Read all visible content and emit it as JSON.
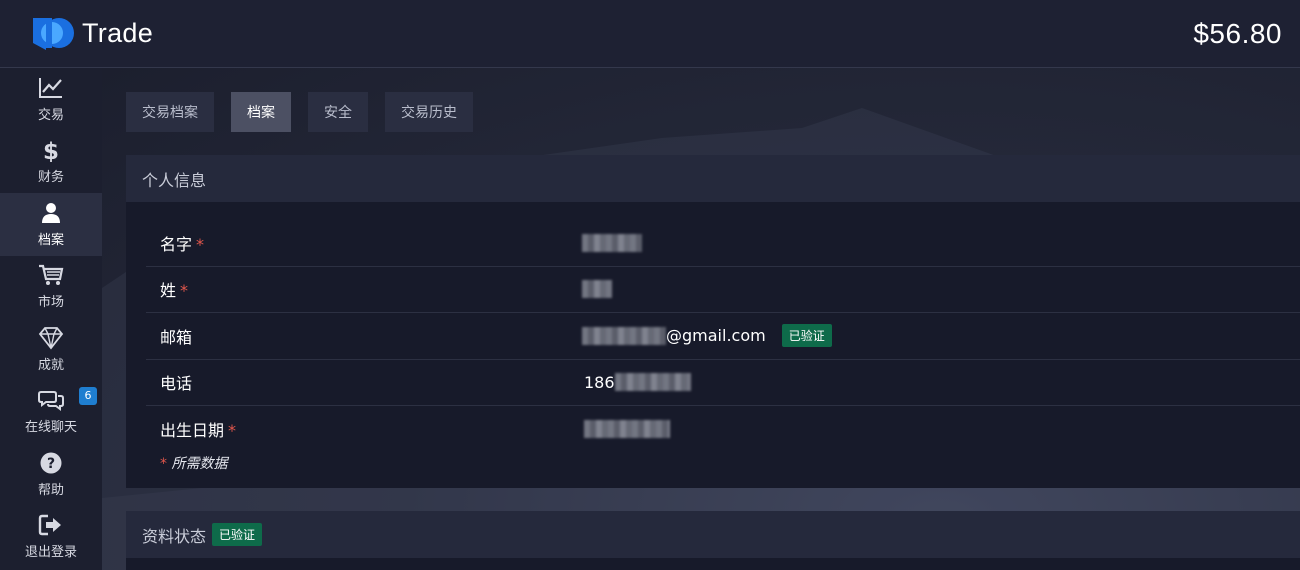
{
  "header": {
    "brand": "Trade",
    "balance": "$56.80"
  },
  "sidebar": {
    "items": [
      {
        "label": "交易",
        "icon": "chart-icon"
      },
      {
        "label": "财务",
        "icon": "dollar-icon"
      },
      {
        "label": "档案",
        "icon": "user-icon",
        "active": true
      },
      {
        "label": "市场",
        "icon": "cart-icon"
      },
      {
        "label": "成就",
        "icon": "diamond-icon"
      },
      {
        "label": "在线聊天",
        "icon": "chat-icon",
        "badge": "6"
      },
      {
        "label": "帮助",
        "icon": "help-icon"
      },
      {
        "label": "退出登录",
        "icon": "logout-icon"
      }
    ]
  },
  "tabs": [
    {
      "label": "交易档案"
    },
    {
      "label": "档案",
      "active": true
    },
    {
      "label": "安全"
    },
    {
      "label": "交易历史"
    }
  ],
  "personal_info": {
    "title": "个人信息",
    "fields": [
      {
        "label": "名字",
        "required": "*"
      },
      {
        "label": "姓",
        "required": "*"
      },
      {
        "label": "邮箱",
        "value_suffix": "@gmail.com",
        "status": "已验证"
      },
      {
        "label": "电话",
        "value_prefix": "186"
      },
      {
        "label": "出生日期",
        "required": "*"
      }
    ],
    "footnote_star": "*",
    "footnote": "所需数据"
  },
  "profile_status": {
    "title": "资料状态",
    "status": "已验证"
  },
  "colors": {
    "verified": "#0e6b4a",
    "required": "#e2574c",
    "badge": "#1f7ed0",
    "logo_blue": "#1a6fe0"
  }
}
